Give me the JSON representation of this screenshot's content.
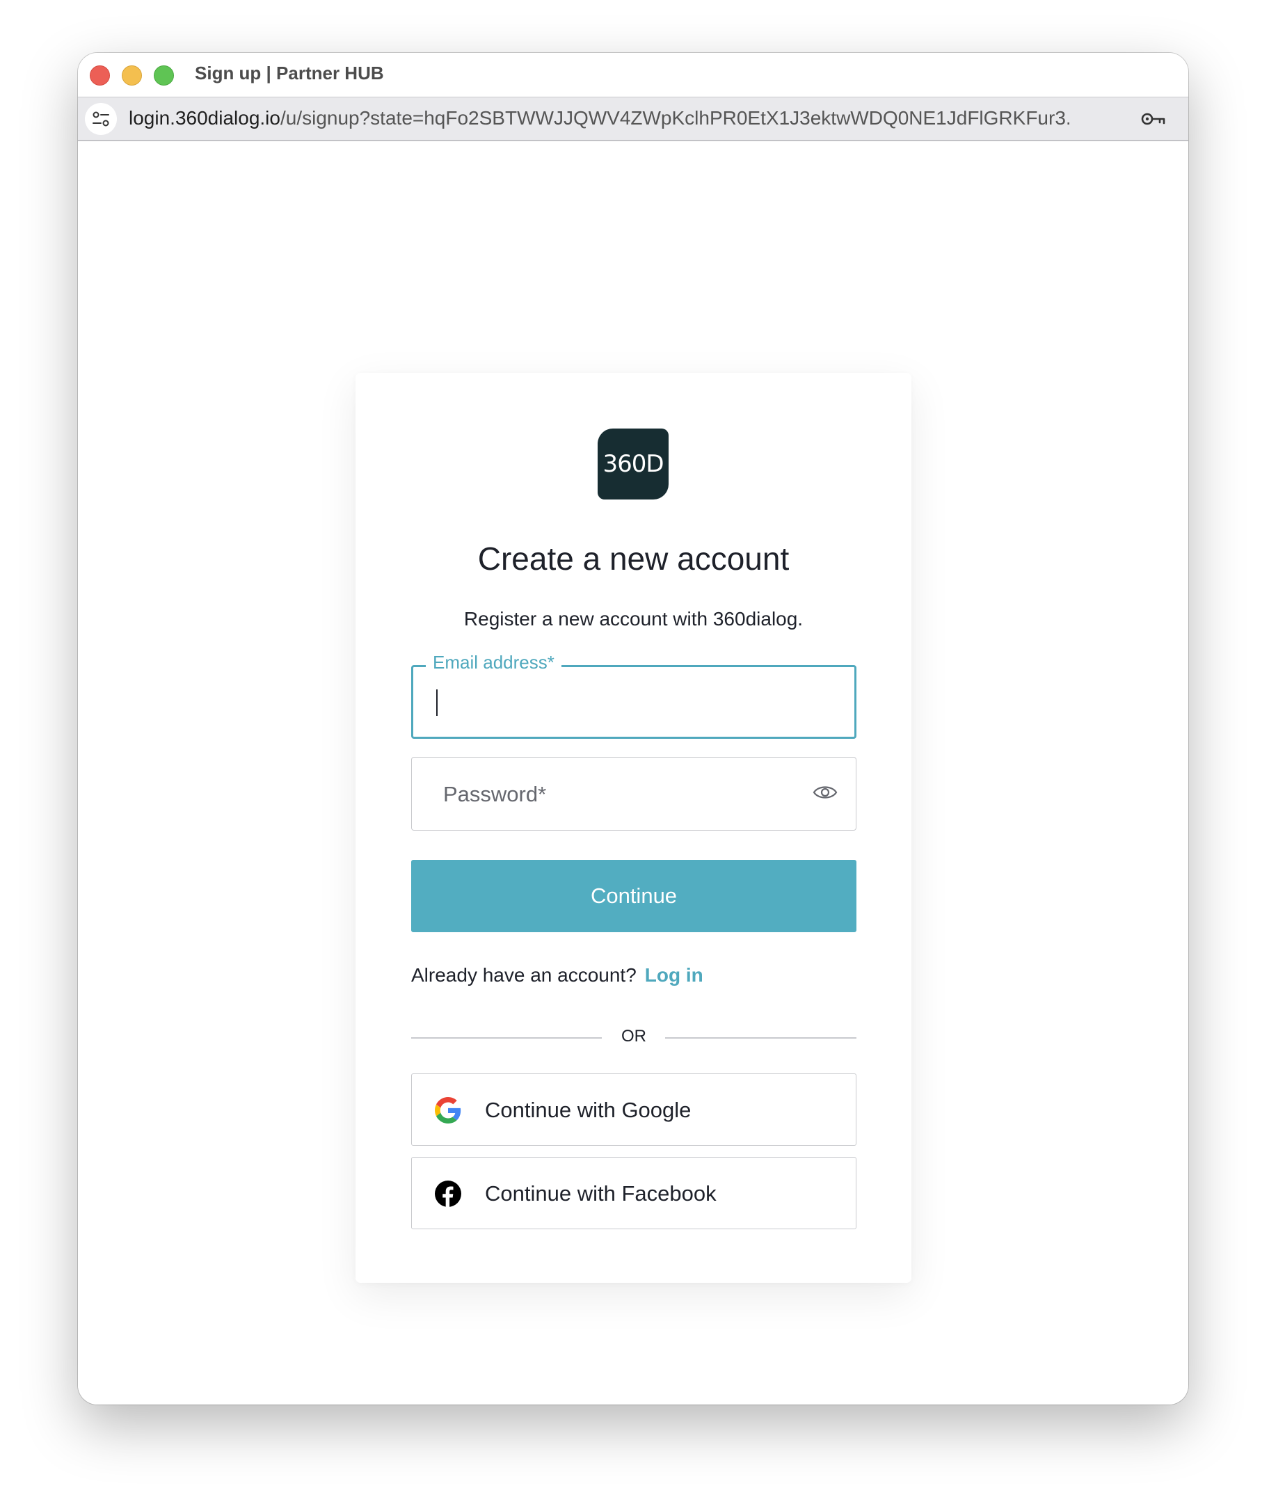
{
  "window": {
    "title": "Sign up | Partner HUB"
  },
  "address_bar": {
    "url_host": "login.360dialog.io",
    "url_path": "/u/signup?state=hqFo2SBTWWJJQWV4ZWpKclhPR0EtX1J3ektwWDQ0NE1JdFlGRKFur3..."
  },
  "logo": {
    "text": "360D"
  },
  "signup": {
    "title": "Create a new account",
    "subtitle": "Register a new account with 360dialog.",
    "email_label": "Email address*",
    "email_value": "",
    "password_placeholder": "Password*",
    "continue_label": "Continue",
    "already_text": "Already have an account?",
    "login_link": "Log in",
    "or_text": "OR",
    "google_label": "Continue with Google",
    "facebook_label": "Continue with Facebook"
  },
  "colors": {
    "accent": "#4fa8bd",
    "button": "#52adc1",
    "logo_bg": "#172d32"
  }
}
